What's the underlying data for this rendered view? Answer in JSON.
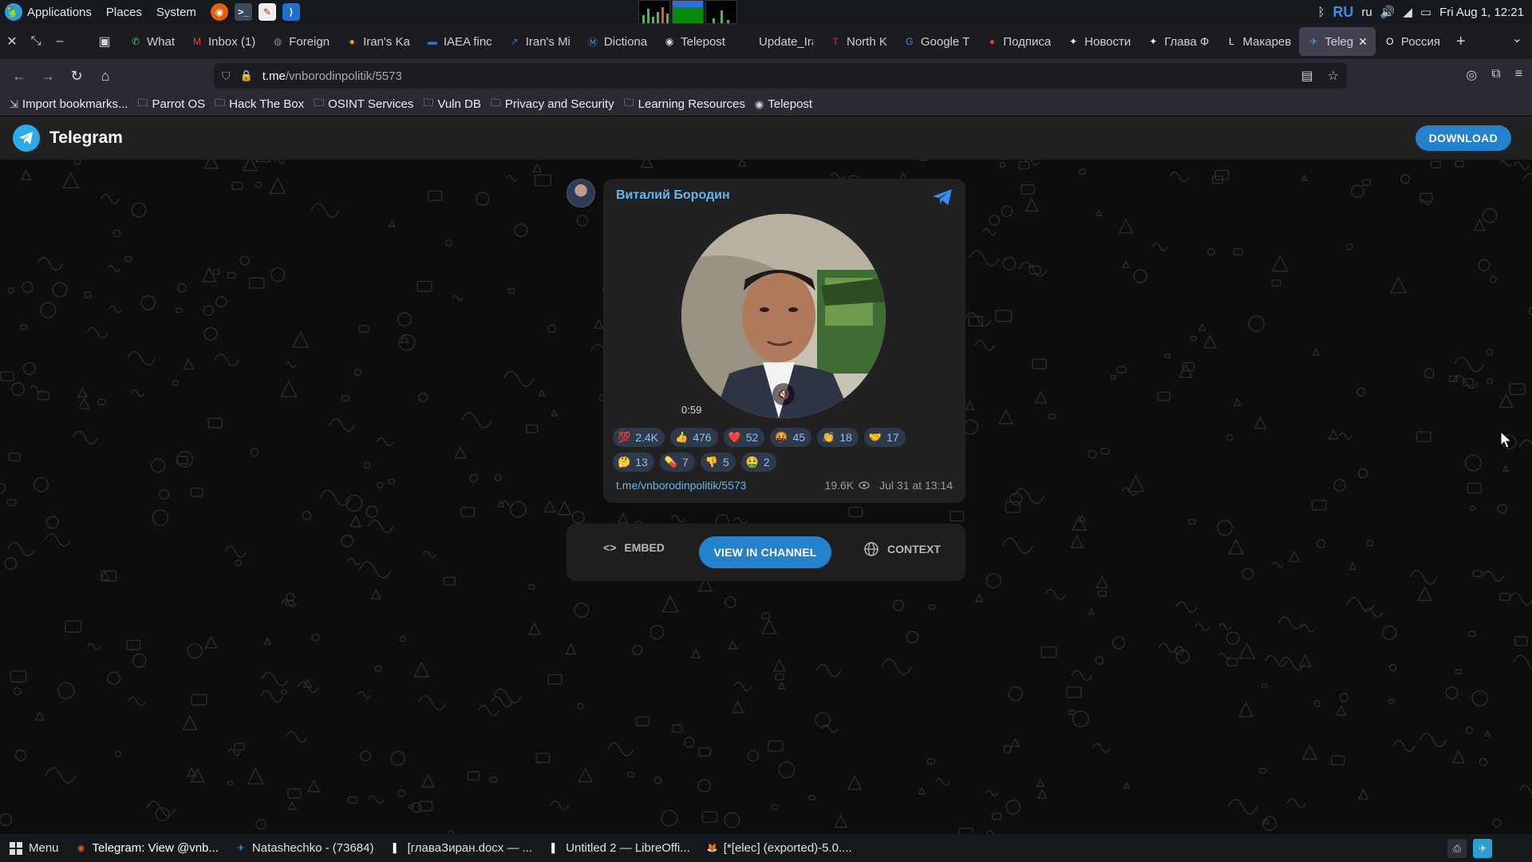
{
  "system_panel": {
    "menus": [
      "Applications",
      "Places",
      "System"
    ],
    "keyboard_layout": "RU",
    "language": "ru",
    "datetime": "Fri Aug 1, 12:21"
  },
  "browser": {
    "tabs": [
      {
        "label": "What",
        "icon": "whatsapp-icon",
        "color": "#25d366"
      },
      {
        "label": "Inbox (1)",
        "icon": "gmail-icon",
        "color": "#ea4335"
      },
      {
        "label": "Foreign",
        "icon": "globe-icon",
        "color": "#888888"
      },
      {
        "label": "Iran's Ka",
        "icon": "site-icon",
        "color": "#e0a020"
      },
      {
        "label": "IAEA finc",
        "icon": "flag-icon",
        "color": "#3a6fd8"
      },
      {
        "label": "Iran's Mi",
        "icon": "chart-icon",
        "color": "#3a7bd5"
      },
      {
        "label": "Dictiona",
        "icon": "dictionary-icon",
        "color": "#4a90e2"
      },
      {
        "label": "Telepost",
        "icon": "telepost-icon",
        "color": "#dddddd"
      },
      {
        "label": "Update_Iran",
        "icon": "blank-icon",
        "color": "#444444"
      },
      {
        "label": "North K",
        "icon": "t-icon",
        "color": "#d32f2f"
      },
      {
        "label": "Google T",
        "icon": "google-translate-icon",
        "color": "#4285f4"
      },
      {
        "label": "Подписа",
        "icon": "site-icon",
        "color": "#e53935"
      },
      {
        "label": "Новости",
        "icon": "star-icon",
        "color": "#ffffff"
      },
      {
        "label": "Глава Ф",
        "icon": "star-icon",
        "color": "#ffffff"
      },
      {
        "label": "Макарев",
        "icon": "l-icon",
        "color": "#ffffff"
      },
      {
        "label": "Teleg",
        "icon": "telegram-icon",
        "color": "#2aabee",
        "active": true
      },
      {
        "label": "Россия",
        "icon": "o-icon",
        "color": "#ffffff"
      }
    ],
    "url_host": "t.me",
    "url_path": "/vnborodinpolitik/5573",
    "bookmarks": [
      {
        "label": "Import bookmarks...",
        "icon": "import-icon"
      },
      {
        "label": "Parrot OS",
        "icon": "folder-icon"
      },
      {
        "label": "Hack The Box",
        "icon": "folder-icon"
      },
      {
        "label": "OSINT Services",
        "icon": "folder-icon"
      },
      {
        "label": "Vuln DB",
        "icon": "folder-icon"
      },
      {
        "label": "Privacy and Security",
        "icon": "folder-icon"
      },
      {
        "label": "Learning Resources",
        "icon": "folder-icon"
      },
      {
        "label": "Telepost",
        "icon": "telepost-icon"
      }
    ]
  },
  "telegram": {
    "app_title": "Telegram",
    "download_label": "DOWNLOAD",
    "message": {
      "author": "Виталий Бородин",
      "video_duration": "0:59",
      "reactions": [
        {
          "emoji": "💯",
          "count": "2.4K"
        },
        {
          "emoji": "👍",
          "count": "476"
        },
        {
          "emoji": "❤️",
          "count": "52"
        },
        {
          "emoji": "🤬",
          "count": "45"
        },
        {
          "emoji": "👏",
          "count": "18"
        },
        {
          "emoji": "🤝",
          "count": "17"
        },
        {
          "emoji": "🤔",
          "count": "13"
        },
        {
          "emoji": "💊",
          "count": "7"
        },
        {
          "emoji": "👎",
          "count": "5"
        },
        {
          "emoji": "🤮",
          "count": "2"
        }
      ],
      "link": "t.me/vnborodinpolitik/5573",
      "views": "19.6K",
      "date": "Jul 31 at 13:14"
    },
    "actions": {
      "embed": "EMBED",
      "view_in_channel": "VIEW IN CHANNEL",
      "context": "CONTEXT"
    }
  },
  "taskbar": {
    "menu_label": "Menu",
    "items": [
      {
        "label": "Telegram: View @vnb...",
        "icon": "firefox-icon",
        "active": true
      },
      {
        "label": "Natashechko - (73684)",
        "icon": "telegram-icon"
      },
      {
        "label": "[главаЗиран.docx — ...",
        "icon": "writer-icon"
      },
      {
        "label": "Untitled 2 — LibreOffi...",
        "icon": "writer-icon"
      },
      {
        "label": "[*[elec] (exported)-5.0....",
        "icon": "gimp-icon"
      }
    ]
  },
  "colors": {
    "accent": "#2481cc",
    "link": "#64b5ef",
    "reaction_bg": "#2e3a4c"
  }
}
